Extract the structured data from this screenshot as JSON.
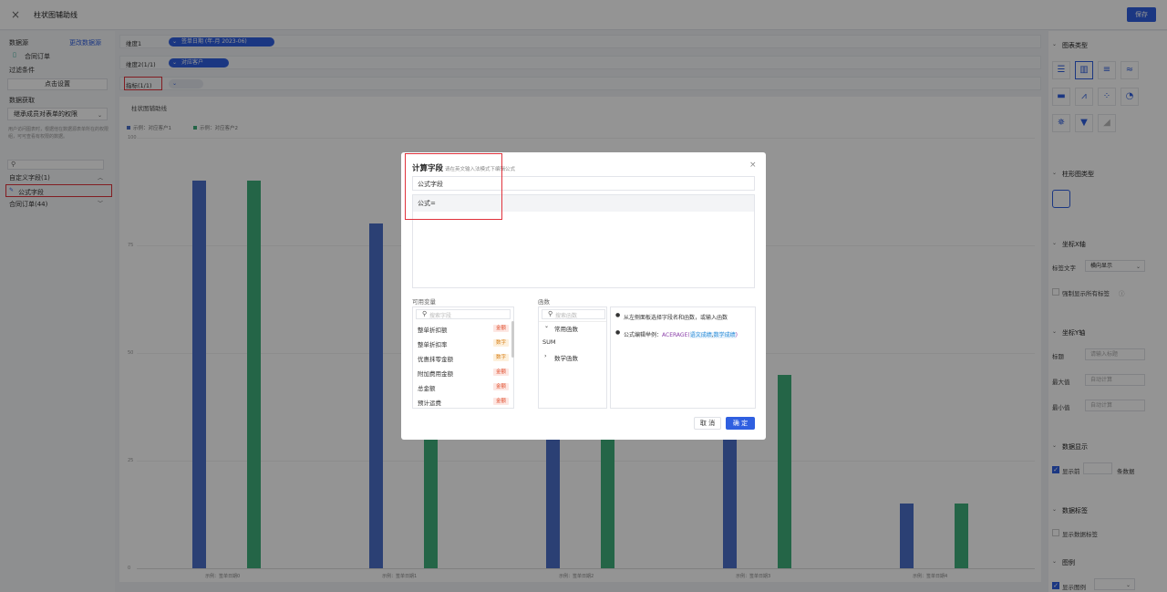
{
  "topbar": {
    "title": "柱状图辅助线",
    "close_icon": "×",
    "save_label": "保存"
  },
  "left": {
    "datasource_label": "数据源",
    "change_source_link": "更改数据源",
    "source_name": "合同订单",
    "filter_label": "过滤条件",
    "filter_button": "点击设置",
    "fetch_label": "数据获取",
    "fetch_select": "继承成员对表单的权限",
    "fetch_desc": "用户访问图表时，根据他在数据源表单所在的权限组，可可查看有权限的数据。",
    "custom_fields_label": "自定义字段(1)",
    "custom_field_item": "公式字段",
    "contract_group": "合同订单(44)"
  },
  "dims": {
    "dim1_label": "维度1",
    "dim1_pill": "签单日期 (年-月 2023-06)",
    "dim2_label": "维度2(1/1)",
    "dim2_pill": "对应客户",
    "metric_label": "指标(1/1)"
  },
  "chart": {
    "title": "柱状图辅助线",
    "legend": [
      "示例：对应客户1",
      "示例：对应客户2"
    ],
    "colors": [
      "#4a6ec9",
      "#3fae7a"
    ],
    "yticks": [
      "100",
      "75",
      "50",
      "25",
      "0"
    ],
    "xticks": [
      "示例：签单日期0",
      "示例：签单日期1",
      "示例：签单日期2",
      "示例：签单日期3",
      "示例：签单日期4"
    ]
  },
  "chart_data": {
    "type": "bar",
    "categories": [
      "示例：签单日期0",
      "示例：签单日期1",
      "示例：签单日期2",
      "示例：签单日期3",
      "示例：签单日期4"
    ],
    "series": [
      {
        "name": "示例：对应客户1",
        "values": [
          90,
          80,
          32,
          32,
          15
        ]
      },
      {
        "name": "示例：对应客户2",
        "values": [
          90,
          32,
          32,
          45,
          15
        ]
      }
    ],
    "title": "柱状图辅助线",
    "xlabel": "",
    "ylabel": "",
    "ylim": [
      0,
      100
    ]
  },
  "right": {
    "chart_type_label": "图表类型",
    "bar_type_label": "柱形图类型",
    "xaxis_label": "坐标X轴",
    "tag_text_label": "标签文字",
    "tag_text_value": "横向显示",
    "force_all_labels": "强制显示所有标签",
    "yaxis_label": "坐标Y轴",
    "title_label": "标题",
    "title_placeholder": "请输入标题",
    "max_label": "最大值",
    "max_placeholder": "自动计算",
    "min_label": "最小值",
    "min_placeholder": "自动计算",
    "data_display_label": "数据显示",
    "show_top_label": "显示前",
    "show_top_suffix": "条数据",
    "data_label_label": "数据标签",
    "show_data_label": "显示数据标签",
    "legend_label": "图例",
    "show_legend": "显示图例"
  },
  "modal": {
    "title": "计算字段",
    "subtitle": "请在英文输入法模式下编辑公式",
    "field_name": "公式字段",
    "formula_prefix": "公式=",
    "vars_label": "可用变量",
    "vars_search_placeholder": "搜索字段",
    "variables": [
      {
        "name": "整单折扣额",
        "tag": "金额",
        "kind": "amount"
      },
      {
        "name": "整单折扣率",
        "tag": "数字",
        "kind": "number"
      },
      {
        "name": "优惠抹零金额",
        "tag": "数字",
        "kind": "number"
      },
      {
        "name": "附加费用金额",
        "tag": "金额",
        "kind": "amount"
      },
      {
        "name": "总金额",
        "tag": "金额",
        "kind": "amount"
      },
      {
        "name": "预计运费",
        "tag": "金额",
        "kind": "amount"
      }
    ],
    "func_label": "函数",
    "func_search_placeholder": "搜索函数",
    "func_group_common": "常用函数",
    "func_sum": "SUM",
    "func_group_math": "数学函数",
    "help_line1": "从左侧面板选择字段名和函数，或输入函数",
    "help_line2_prefix": "公式编辑举例：",
    "help_func": "ACERAGE(",
    "help_arg1": "语文成绩",
    "help_comma": ",",
    "help_arg2": "数学成绩",
    "help_close": ")",
    "cancel": "取 消",
    "ok": "确 定"
  }
}
